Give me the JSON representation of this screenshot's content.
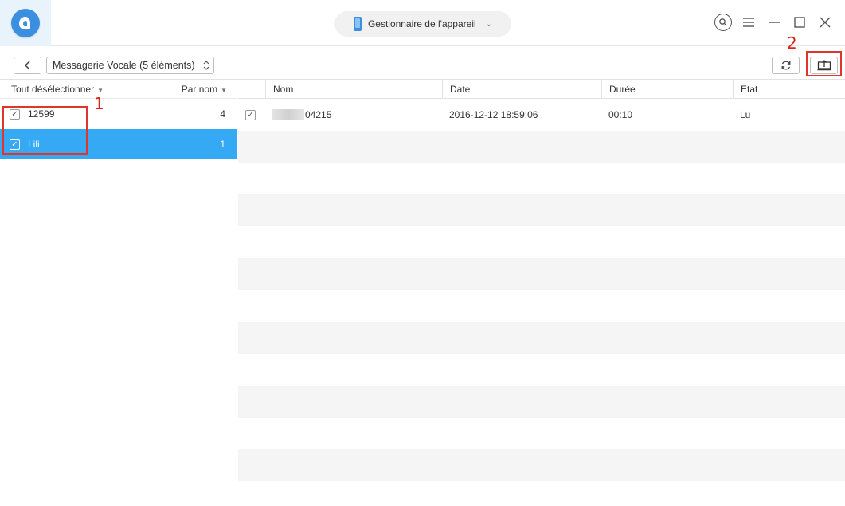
{
  "header": {
    "device_label": "Gestionnaire de l'appareil",
    "device_chevron": "⌄",
    "app_icon": "airmore-logo-icon",
    "search_icon": "search-circle-icon",
    "menu_icon": "hamburger-menu-icon",
    "minimize_icon": "minimize-icon",
    "maximize_icon": "maximize-icon",
    "close_icon": "close-icon"
  },
  "toolbar": {
    "back_icon": "chevron-left-icon",
    "category_select": "Messagerie Vocale (5 éléments)",
    "refresh_icon": "refresh-icon",
    "export_icon": "export-to-computer-icon"
  },
  "annotations": {
    "marker_1": "1",
    "marker_2": "2",
    "highlight_color": "#e0352b"
  },
  "left_panel": {
    "select_all_label": "Tout désélectionner",
    "sort_label": "Par nom",
    "contacts": [
      {
        "name": "12599",
        "count": "4",
        "checked": true,
        "selected": false
      },
      {
        "name": "Lili",
        "count": "1",
        "checked": true,
        "selected": true
      }
    ]
  },
  "table": {
    "columns": [
      "Nom",
      "Date",
      "Durée",
      "Etat"
    ],
    "rows": [
      {
        "checked": true,
        "name": "04215",
        "date": "2016-12-12 18:59:06",
        "duration": "00:10",
        "state": "Lu"
      }
    ]
  },
  "colors": {
    "accent": "#36a9f4",
    "logo": "#3a8fe0",
    "stripe": "#f5f5f5"
  }
}
